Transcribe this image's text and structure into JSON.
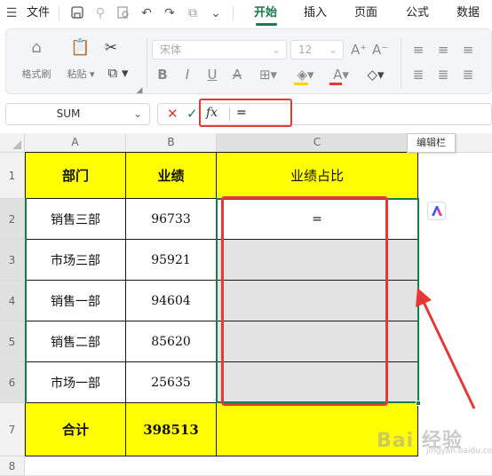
{
  "menubar": {
    "file_label": "文件",
    "tabs": [
      "开始",
      "插入",
      "页面",
      "公式",
      "数据"
    ],
    "active_tab": "开始",
    "accent_color": "#1a7a49"
  },
  "ribbon": {
    "format_painter": "格式刷",
    "paste": "粘贴",
    "font_name": "宋体",
    "font_size": "12"
  },
  "formula_bar": {
    "name_box": "SUM",
    "fx_label": "fx",
    "formula": "="
  },
  "tooltip": "编辑栏",
  "columns": [
    "A",
    "B",
    "C"
  ],
  "rows": [
    "1",
    "2",
    "3",
    "4",
    "5",
    "6",
    "7",
    "8"
  ],
  "table": {
    "header": [
      "部门",
      "业绩",
      "业绩占比"
    ],
    "body": [
      [
        "销售三部",
        "96733",
        "="
      ],
      [
        "市场三部",
        "95921",
        ""
      ],
      [
        "销售一部",
        "94604",
        ""
      ],
      [
        "销售二部",
        "85620",
        ""
      ],
      [
        "市场一部",
        "25635",
        ""
      ]
    ],
    "total": [
      "合计",
      "398513",
      ""
    ]
  },
  "colors": {
    "header_fill": "#ffff00",
    "selection_fill": "#e3e3e3",
    "annotation": "#e53935",
    "selection_border": "#1a7a49"
  },
  "icons": [
    "save-icon",
    "undo-icon",
    "redo-icon",
    "cut-icon",
    "paste-icon",
    "bold-icon",
    "italic-icon",
    "underline-icon",
    "strikethrough-icon",
    "border-icon",
    "fill-color-icon",
    "font-color-icon",
    "clear-icon",
    "cancel-icon",
    "confirm-icon",
    "ai-assistant-icon"
  ],
  "watermark": "Bai 经验",
  "watermark_sub": "jingyan.baidu.com"
}
